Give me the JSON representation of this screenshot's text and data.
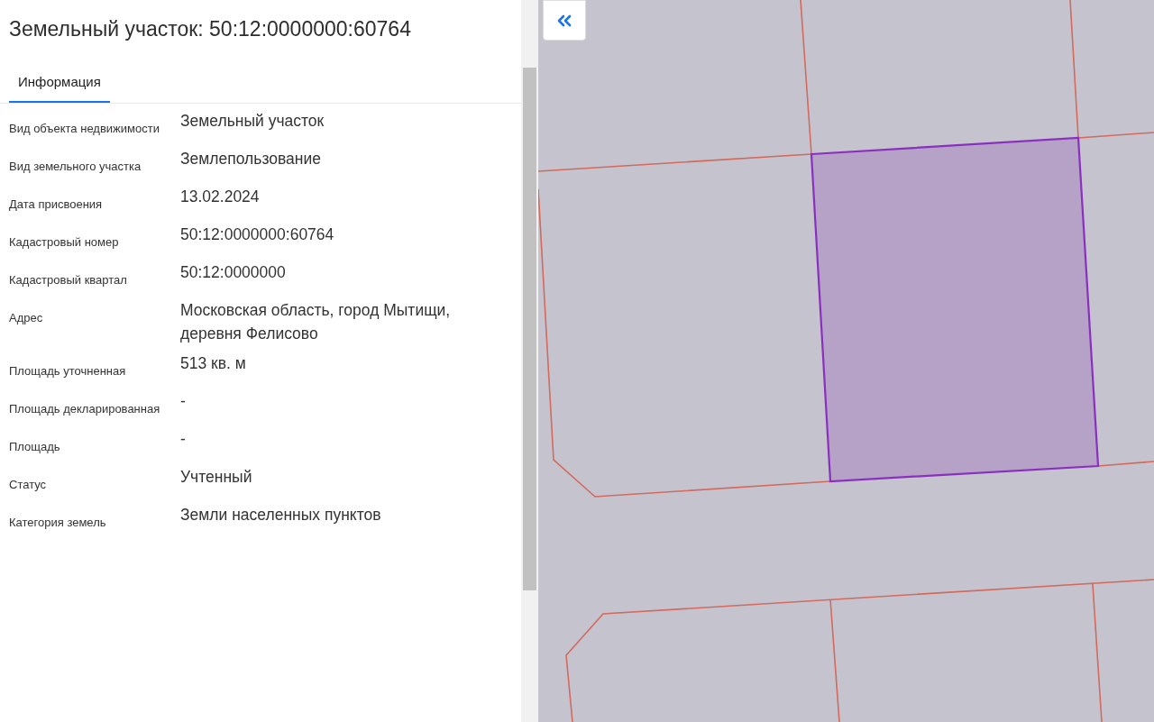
{
  "title": "Земельный участок: 50:12:0000000:60764",
  "tabs": [
    {
      "label": "Информация",
      "selected": true
    }
  ],
  "fields": [
    {
      "label": "Вид объекта недвижимости",
      "value": "Земельный участок"
    },
    {
      "label": "Вид земельного участка",
      "value": "Землепользование"
    },
    {
      "label": "Дата присвоения",
      "value": "13.02.2024"
    },
    {
      "label": "Кадастровый номер",
      "value": "50:12:0000000:60764"
    },
    {
      "label": "Кадастровый квартал",
      "value": "50:12:0000000"
    },
    {
      "label": "Адрес",
      "value": "Московская область, город Мытищи, деревня Фелисово"
    },
    {
      "label": "Площадь уточненная",
      "value": "513 кв. м"
    },
    {
      "label": "Площадь декларированная",
      "value": "-"
    },
    {
      "label": "Площадь",
      "value": "-"
    },
    {
      "label": "Статус",
      "value": "Учтенный"
    },
    {
      "label": "Категория земель",
      "value": "Земли населенных пунктов"
    }
  ]
}
